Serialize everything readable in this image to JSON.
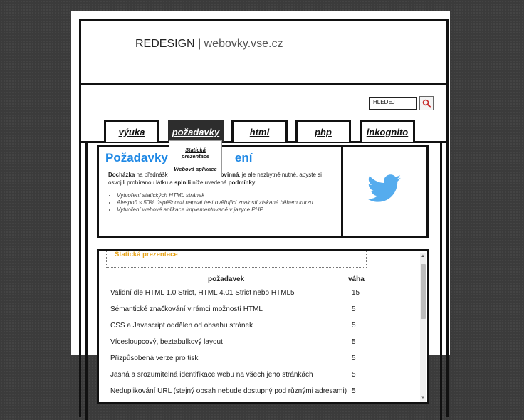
{
  "header": {
    "title_prefix": "REDESIGN",
    "separator": " | ",
    "title_link": "webovky.vse.cz"
  },
  "search": {
    "placeholder": "HLEDEJ",
    "button_icon": "magnifier-icon"
  },
  "nav": {
    "tabs": [
      {
        "label": "výuka"
      },
      {
        "label": "požadavky"
      },
      {
        "label": "html"
      },
      {
        "label": "php"
      },
      {
        "label": "inkognito"
      }
    ],
    "active_tab": "požadavky",
    "dropdown": {
      "items": [
        {
          "label_line1": "Statická",
          "label_line2": "prezentace"
        },
        {
          "label": "Webová aplikace"
        }
      ]
    }
  },
  "content": {
    "heading_visible_start": "Požadavky",
    "heading_visible_end": "ení",
    "intro": {
      "bold1": "Docházka",
      "text1": " na přednášk",
      "bold2": "ovinná",
      "text2": ", je ale nezbytně nutné, abyste si osvojili probíranou látku a ",
      "bold3": "splnili",
      "text3": " níže uvedené ",
      "bold4": "podmínky",
      "text4": ":"
    },
    "list": [
      "Vytvoření statických HTML stránek",
      "Alespoň s 50% úspěšností napsat test ověřující znalosti získané během kurzu",
      "Vytvoření webové aplikace implementované v jazyce PHP"
    ],
    "sidebar_icon": "twitter-bird-icon"
  },
  "modal": {
    "legend": "Statická prezentace",
    "headers": {
      "requirement": "požadavek",
      "weight": "váha"
    },
    "rows": [
      {
        "requirement": "Validní dle HTML 1.0 Strict, HTML 4.01 Strict nebo HTML5",
        "weight": "15"
      },
      {
        "requirement": "Sémantické značkování v rámci možností HTML",
        "weight": "5"
      },
      {
        "requirement": "CSS a Javascript oddělen od obsahu stránek",
        "weight": "5"
      },
      {
        "requirement": "Vícesloupcový, beztabulkový layout",
        "weight": "5"
      },
      {
        "requirement": "Přizpůsobená verze pro tisk",
        "weight": "5"
      },
      {
        "requirement": "Jasná a srozumitelná identifikace webu na všech jeho stránkách",
        "weight": "5"
      },
      {
        "requirement": "Neduplikování URL (stejný obsah nebude dostupný pod různými adresami)",
        "weight": "5"
      }
    ]
  },
  "colors": {
    "heading_blue": "#1e88e5",
    "legend_orange": "#e8a317",
    "twitter_blue": "#55acee",
    "active_tab": "#2d2d2d"
  }
}
